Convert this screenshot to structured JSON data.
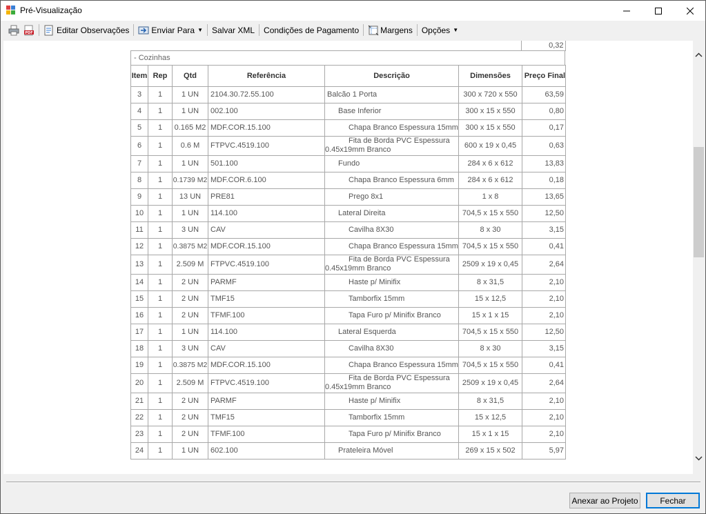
{
  "window": {
    "title": "Pré-Visualização"
  },
  "toolbar": {
    "print_icon": "printer-icon",
    "pdf_icon": "pdf-icon",
    "editar_observacoes": "Editar Observações",
    "enviar_para": "Enviar Para",
    "salvar_xml": "Salvar XML",
    "condicoes_pagamento": "Condições de Pagamento",
    "margens": "Margens",
    "opcoes": "Opções"
  },
  "report": {
    "top_value": "0,32",
    "section": "- Cozinhas",
    "headers": {
      "item": "Item",
      "rep": "Rep",
      "qtd": "Qtd",
      "referencia": "Referência",
      "descricao": "Descrição",
      "dimensoes": "Dimensões",
      "preco_final": "Preço Final"
    },
    "rows": [
      {
        "item": "3",
        "rep": "1",
        "qtd": "1 UN",
        "ref": "2104.30.72.55.100",
        "desc": "Balcão 1 Porta",
        "dim": "300 x 720 x 550",
        "preco": "63,59",
        "level": 0
      },
      {
        "item": "4",
        "rep": "1",
        "qtd": "1 UN",
        "ref": "002.100",
        "desc": "Base Inferior",
        "dim": "300 x 15 x 550",
        "preco": "0,80",
        "level": 1
      },
      {
        "item": "5",
        "rep": "1",
        "qtd": "0.165 M2",
        "ref": "MDF.COR.15.100",
        "desc": "Chapa Branco Espessura 15mm",
        "dim": "300 x 15 x 550",
        "preco": "0,17",
        "level": 2
      },
      {
        "item": "6",
        "rep": "1",
        "qtd": "0.6 M",
        "ref": "FTPVC.4519.100",
        "desc": "Fita de Borda PVC Espessura 0.45x19mm Branco",
        "dim": "600 x 19 x 0,45",
        "preco": "0,63",
        "level": 2,
        "wrap": true
      },
      {
        "item": "7",
        "rep": "1",
        "qtd": "1 UN",
        "ref": "501.100",
        "desc": "Fundo",
        "dim": "284 x 6 x 612",
        "preco": "13,83",
        "level": 1
      },
      {
        "item": "8",
        "rep": "1",
        "qtd": "0.1739 M2",
        "ref": "MDF.COR.6.100",
        "desc": "Chapa Branco Espessura 6mm",
        "dim": "284 x 6 x 612",
        "preco": "0,18",
        "level": 2
      },
      {
        "item": "9",
        "rep": "1",
        "qtd": "13 UN",
        "ref": "PRE81",
        "desc": "Prego 8x1",
        "dim": "1 x 8",
        "preco": "13,65",
        "level": 2
      },
      {
        "item": "10",
        "rep": "1",
        "qtd": "1 UN",
        "ref": "114.100",
        "desc": "Lateral Direita",
        "dim": "704,5 x 15 x 550",
        "preco": "12,50",
        "level": 1
      },
      {
        "item": "11",
        "rep": "1",
        "qtd": "3 UN",
        "ref": "CAV",
        "desc": "Cavilha 8X30",
        "dim": "8 x 30",
        "preco": "3,15",
        "level": 2
      },
      {
        "item": "12",
        "rep": "1",
        "qtd": "0.3875 M2",
        "ref": "MDF.COR.15.100",
        "desc": "Chapa Branco Espessura 15mm",
        "dim": "704,5 x 15 x 550",
        "preco": "0,41",
        "level": 2
      },
      {
        "item": "13",
        "rep": "1",
        "qtd": "2.509 M",
        "ref": "FTPVC.4519.100",
        "desc": "Fita de Borda PVC Espessura 0.45x19mm Branco",
        "dim": "2509 x 19 x 0,45",
        "preco": "2,64",
        "level": 2,
        "wrap": true
      },
      {
        "item": "14",
        "rep": "1",
        "qtd": "2 UN",
        "ref": "PARMF",
        "desc": "Haste p/ Minifix",
        "dim": "8 x 31,5",
        "preco": "2,10",
        "level": 2
      },
      {
        "item": "15",
        "rep": "1",
        "qtd": "2 UN",
        "ref": "TMF15",
        "desc": "Tamborfix 15mm",
        "dim": "15 x 12,5",
        "preco": "2,10",
        "level": 2
      },
      {
        "item": "16",
        "rep": "1",
        "qtd": "2 UN",
        "ref": "TFMF.100",
        "desc": "Tapa Furo p/ Minifix Branco",
        "dim": "15 x 1 x 15",
        "preco": "2,10",
        "level": 2
      },
      {
        "item": "17",
        "rep": "1",
        "qtd": "1 UN",
        "ref": "114.100",
        "desc": "Lateral Esquerda",
        "dim": "704,5 x 15 x 550",
        "preco": "12,50",
        "level": 1
      },
      {
        "item": "18",
        "rep": "1",
        "qtd": "3 UN",
        "ref": "CAV",
        "desc": "Cavilha 8X30",
        "dim": "8 x 30",
        "preco": "3,15",
        "level": 2
      },
      {
        "item": "19",
        "rep": "1",
        "qtd": "0.3875 M2",
        "ref": "MDF.COR.15.100",
        "desc": "Chapa Branco Espessura 15mm",
        "dim": "704,5 x 15 x 550",
        "preco": "0,41",
        "level": 2
      },
      {
        "item": "20",
        "rep": "1",
        "qtd": "2.509 M",
        "ref": "FTPVC.4519.100",
        "desc": "Fita de Borda PVC Espessura 0.45x19mm Branco",
        "dim": "2509 x 19 x 0,45",
        "preco": "2,64",
        "level": 2,
        "wrap": true
      },
      {
        "item": "21",
        "rep": "1",
        "qtd": "2 UN",
        "ref": "PARMF",
        "desc": "Haste p/ Minifix",
        "dim": "8 x 31,5",
        "preco": "2,10",
        "level": 2
      },
      {
        "item": "22",
        "rep": "1",
        "qtd": "2 UN",
        "ref": "TMF15",
        "desc": "Tamborfix 15mm",
        "dim": "15 x 12,5",
        "preco": "2,10",
        "level": 2
      },
      {
        "item": "23",
        "rep": "1",
        "qtd": "2 UN",
        "ref": "TFMF.100",
        "desc": "Tapa Furo p/ Minifix Branco",
        "dim": "15 x 1 x 15",
        "preco": "2,10",
        "level": 2
      },
      {
        "item": "24",
        "rep": "1",
        "qtd": "1 UN",
        "ref": "602.100",
        "desc": "Prateleira Móvel",
        "dim": "269 x 15 x 502",
        "preco": "5,97",
        "level": 1
      }
    ]
  },
  "footer": {
    "anexar": "Anexar ao Projeto",
    "fechar": "Fechar"
  }
}
